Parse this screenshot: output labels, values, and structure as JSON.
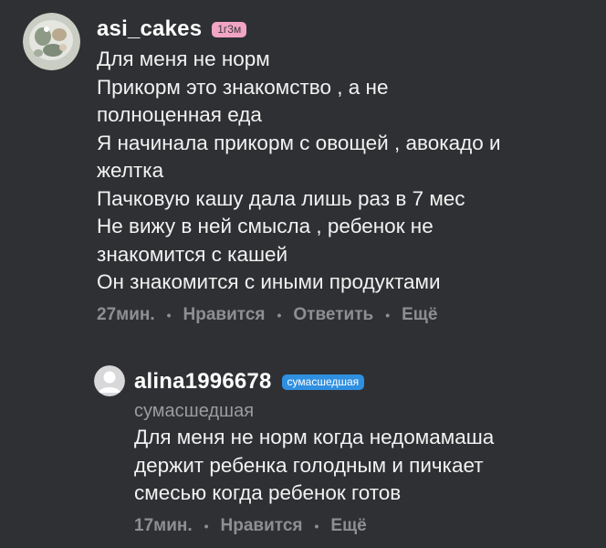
{
  "comment": {
    "username": "asi_cakes",
    "badge": "1г3м",
    "lines": [
      "Для меня не норм",
      "Прикорм это знакомство , а не",
      "полноценная еда",
      "Я начинала прикорм с овощей , авокадо и",
      "желтка",
      "Пачковую кашу дала лишь раз в 7 мес",
      "Не вижу в ней смысла , ребенок не",
      "знакомится с кашей",
      "Он знакомится с иными продуктами"
    ],
    "time": "27мин.",
    "like_label": "Нравится",
    "reply_label": "Ответить",
    "more_label": "Ещё",
    "separator": "•"
  },
  "reply": {
    "username": "alina1996678",
    "badge": "сумасшедшая",
    "status": "сумасшедшая",
    "lines": [
      "Для меня не норм когда недомамаша",
      "держит ребенка голодным и пичкает",
      "смесью когда ребенок готов"
    ],
    "time": "17мин.",
    "like_label": "Нравится",
    "more_label": "Ещё",
    "separator": "•"
  },
  "colors": {
    "background": "#2f3033",
    "text": "#f2f2f2",
    "muted": "#8e8f93",
    "badge_pink": "#f2a4c4",
    "badge_blue": "#2f8fe0"
  }
}
